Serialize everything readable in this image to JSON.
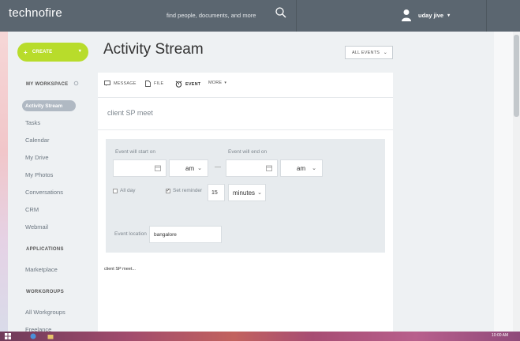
{
  "app": {
    "logo": "technofire",
    "search_placeholder": "find people, documents, and more",
    "user_name": "uday jive"
  },
  "sidebar": {
    "create_label": "CREATE",
    "workspace_heading": "MY WORKSPACE",
    "active_item": "Activity Stream",
    "items": [
      "Tasks",
      "Calendar",
      "My Drive",
      "My Photos",
      "Conversations",
      "CRM",
      "Webmail"
    ],
    "applications_heading": "APPLICATIONS",
    "applications": [
      "Marketplace"
    ],
    "workgroups_heading": "WORKGROUPS",
    "workgroups": [
      "All Workgroups",
      "Freelance"
    ]
  },
  "main": {
    "title": "Activity Stream",
    "filter_label": "ALL EVENTS",
    "tabs": [
      {
        "label": "MESSAGE",
        "icon": "message-icon"
      },
      {
        "label": "FILE",
        "icon": "file-icon"
      },
      {
        "label": "EVENT",
        "icon": "event-icon"
      },
      {
        "label": "MORE",
        "icon": "chevron-down-icon"
      }
    ],
    "event_title": "client SP meet",
    "start_label": "Event will start on",
    "end_label": "Event will end on",
    "start_ampm": "am",
    "end_ampm": "am",
    "dash": "—",
    "all_day_label": "All day",
    "set_reminder_label": "Set reminder",
    "reminder_value": "15",
    "reminder_unit": "minutes",
    "location_label": "Event location",
    "location_value": "bangalore",
    "preview_text": "client SP meet..."
  },
  "taskbar": {
    "clock": "10:00 AM"
  },
  "colors": {
    "topbar": "#5b6670",
    "create_button": "#b8dc2b",
    "active_nav": "#b0b9c3"
  }
}
